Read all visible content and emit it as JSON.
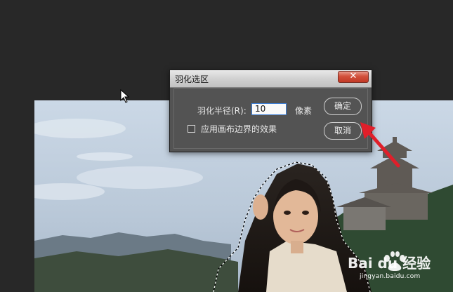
{
  "dialog": {
    "title": "羽化选区",
    "close_glyph": "✕",
    "radius_label": "羽化半径(R):",
    "radius_value": "10",
    "radius_unit": "像素",
    "checkbox_label": "应用画布边界的效果",
    "checkbox_checked": false,
    "ok_label": "确定",
    "cancel_label": "取消"
  },
  "watermark": {
    "brand": "Bai du 经验",
    "url": "jingyan.baidu.com"
  },
  "colors": {
    "workspace": "#282828",
    "dialog_bg": "#535353",
    "close_button": "#c94a35",
    "input_border": "#3d7fd6",
    "arrow": "#e01f2a"
  },
  "icons": [
    "mouse-cursor-icon",
    "close-icon",
    "checkbox-icon",
    "red-arrow-icon",
    "baidu-paw-icon"
  ]
}
